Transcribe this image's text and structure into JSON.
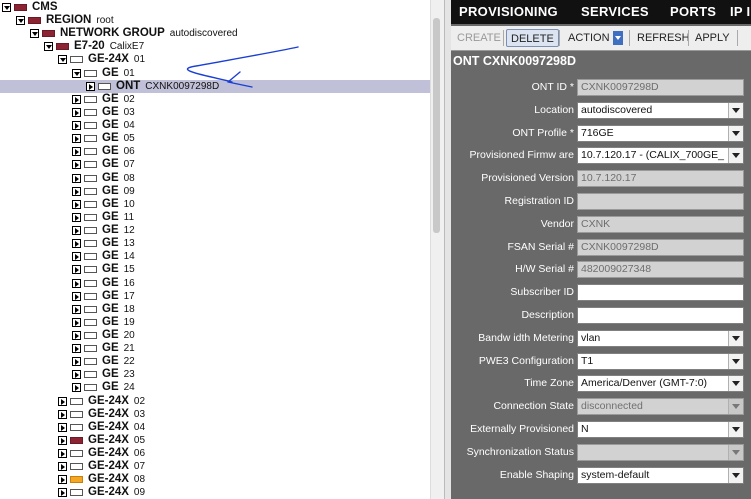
{
  "tree": {
    "rows": [
      {
        "label": "CMS",
        "sub": "",
        "icon": "red",
        "toggle": "exp",
        "indent": 0
      },
      {
        "label": "REGION",
        "sub": "root",
        "icon": "red",
        "toggle": "exp",
        "indent": 1
      },
      {
        "label": "NETWORK GROUP",
        "sub": "autodiscovered",
        "icon": "red",
        "toggle": "exp",
        "indent": 2
      },
      {
        "label": "E7-20",
        "sub": "CalixE7",
        "icon": "red",
        "toggle": "exp",
        "indent": 3
      },
      {
        "label": "GE-24X",
        "sub": "01",
        "icon": "white",
        "toggle": "exp",
        "indent": 4
      },
      {
        "label": "GE",
        "sub": "01",
        "icon": "white",
        "toggle": "exp",
        "indent": 5
      },
      {
        "label": "ONT",
        "sub": "CXNK0097298D",
        "icon": "white",
        "toggle": "col",
        "indent": 6,
        "selected": true
      },
      {
        "label": "GE",
        "sub": "02",
        "icon": "white",
        "toggle": "col",
        "indent": 5
      },
      {
        "label": "GE",
        "sub": "03",
        "icon": "white",
        "toggle": "col",
        "indent": 5
      },
      {
        "label": "GE",
        "sub": "04",
        "icon": "white",
        "toggle": "col",
        "indent": 5
      },
      {
        "label": "GE",
        "sub": "05",
        "icon": "white",
        "toggle": "col",
        "indent": 5
      },
      {
        "label": "GE",
        "sub": "06",
        "icon": "white",
        "toggle": "col",
        "indent": 5
      },
      {
        "label": "GE",
        "sub": "07",
        "icon": "white",
        "toggle": "col",
        "indent": 5
      },
      {
        "label": "GE",
        "sub": "08",
        "icon": "white",
        "toggle": "col",
        "indent": 5
      },
      {
        "label": "GE",
        "sub": "09",
        "icon": "white",
        "toggle": "col",
        "indent": 5
      },
      {
        "label": "GE",
        "sub": "10",
        "icon": "white",
        "toggle": "col",
        "indent": 5
      },
      {
        "label": "GE",
        "sub": "11",
        "icon": "white",
        "toggle": "col",
        "indent": 5
      },
      {
        "label": "GE",
        "sub": "12",
        "icon": "white",
        "toggle": "col",
        "indent": 5
      },
      {
        "label": "GE",
        "sub": "13",
        "icon": "white",
        "toggle": "col",
        "indent": 5
      },
      {
        "label": "GE",
        "sub": "14",
        "icon": "white",
        "toggle": "col",
        "indent": 5
      },
      {
        "label": "GE",
        "sub": "15",
        "icon": "white",
        "toggle": "col",
        "indent": 5
      },
      {
        "label": "GE",
        "sub": "16",
        "icon": "white",
        "toggle": "col",
        "indent": 5
      },
      {
        "label": "GE",
        "sub": "17",
        "icon": "white",
        "toggle": "col",
        "indent": 5
      },
      {
        "label": "GE",
        "sub": "18",
        "icon": "white",
        "toggle": "col",
        "indent": 5
      },
      {
        "label": "GE",
        "sub": "19",
        "icon": "white",
        "toggle": "col",
        "indent": 5
      },
      {
        "label": "GE",
        "sub": "20",
        "icon": "white",
        "toggle": "col",
        "indent": 5
      },
      {
        "label": "GE",
        "sub": "21",
        "icon": "white",
        "toggle": "col",
        "indent": 5
      },
      {
        "label": "GE",
        "sub": "22",
        "icon": "white",
        "toggle": "col",
        "indent": 5
      },
      {
        "label": "GE",
        "sub": "23",
        "icon": "white",
        "toggle": "col",
        "indent": 5
      },
      {
        "label": "GE",
        "sub": "24",
        "icon": "white",
        "toggle": "col",
        "indent": 5
      },
      {
        "label": "GE-24X",
        "sub": "02",
        "icon": "white",
        "toggle": "col",
        "indent": 4
      },
      {
        "label": "GE-24X",
        "sub": "03",
        "icon": "white",
        "toggle": "col",
        "indent": 4
      },
      {
        "label": "GE-24X",
        "sub": "04",
        "icon": "white",
        "toggle": "col",
        "indent": 4
      },
      {
        "label": "GE-24X",
        "sub": "05",
        "icon": "red",
        "toggle": "col",
        "indent": 4
      },
      {
        "label": "GE-24X",
        "sub": "06",
        "icon": "white",
        "toggle": "col",
        "indent": 4
      },
      {
        "label": "GE-24X",
        "sub": "07",
        "icon": "white",
        "toggle": "col",
        "indent": 4
      },
      {
        "label": "GE-24X",
        "sub": "08",
        "icon": "orange",
        "toggle": "col",
        "indent": 4
      },
      {
        "label": "GE-24X",
        "sub": "09",
        "icon": "white",
        "toggle": "col",
        "indent": 4
      }
    ]
  },
  "nav": {
    "tabs": [
      "PROVISIONING",
      "SERVICES",
      "PORTS",
      "IP I"
    ]
  },
  "toolbar": {
    "create": "CREATE",
    "delete": "DELETE",
    "action": "ACTION",
    "refresh": "REFRESH",
    "apply": "APPLY"
  },
  "form": {
    "title": "ONT CXNK0097298D",
    "fields": [
      {
        "label": "ONT ID *",
        "value": "CXNK0097298D",
        "kind": "ro"
      },
      {
        "label": "Location",
        "value": "autodiscovered",
        "kind": "sel"
      },
      {
        "label": "ONT Profile *",
        "value": "716GE",
        "kind": "sel"
      },
      {
        "label": "Provisioned Firmw are",
        "value": "10.7.120.17 - (CALIX_700GE_",
        "kind": "sel"
      },
      {
        "label": "Provisioned Version",
        "value": "10.7.120.17",
        "kind": "ro"
      },
      {
        "label": "Registration ID",
        "value": "",
        "kind": "ro"
      },
      {
        "label": "Vendor",
        "value": "CXNK",
        "kind": "ro"
      },
      {
        "label": "FSAN Serial #",
        "value": "CXNK0097298D",
        "kind": "ro"
      },
      {
        "label": "H/W Serial #",
        "value": "482009027348",
        "kind": "ro"
      },
      {
        "label": "Subscriber ID",
        "value": "",
        "kind": "ed"
      },
      {
        "label": "Description",
        "value": "",
        "kind": "ed"
      },
      {
        "label": "Bandw idth Metering",
        "value": "vlan",
        "kind": "sel"
      },
      {
        "label": "PWE3 Configuration",
        "value": "T1",
        "kind": "sel"
      },
      {
        "label": "Time Zone",
        "value": "America/Denver (GMT-7:0)",
        "kind": "sel"
      },
      {
        "label": "Connection State",
        "value": "disconnected",
        "kind": "seldis"
      },
      {
        "label": "Externally Provisioned",
        "value": "N",
        "kind": "sel"
      },
      {
        "label": "Synchronization Status",
        "value": "",
        "kind": "seldis"
      },
      {
        "label": "Enable Shaping",
        "value": "system-default",
        "kind": "sel"
      }
    ]
  },
  "colors": {
    "panel_bg": "#696969",
    "nav_bg": "#111111",
    "node_red": "#8b2332",
    "node_orange": "#f5a623",
    "annotation_blue": "#1a3fd4"
  }
}
